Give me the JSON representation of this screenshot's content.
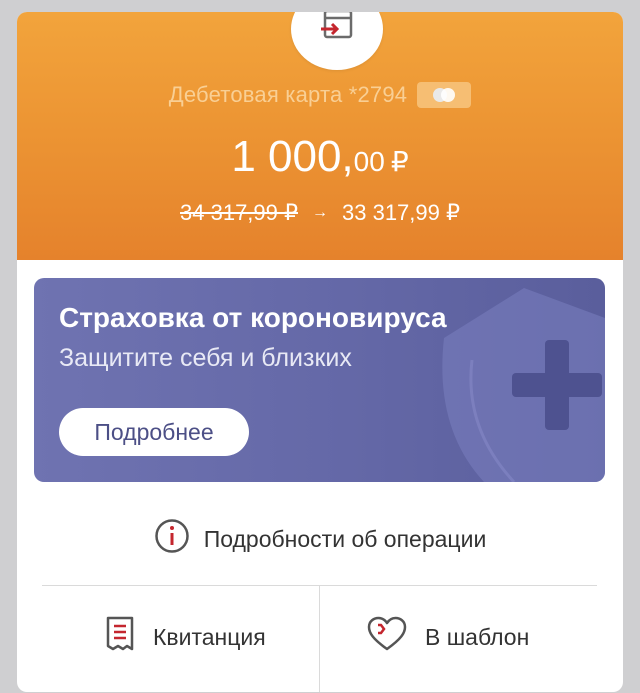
{
  "header": {
    "card_name": "Дебетовая карта *2794",
    "amount_int": "1 000,",
    "amount_frac": "00",
    "amount_currency": "₽",
    "balance_old": "34 317,99 ₽",
    "balance_arrow": "→",
    "balance_new": "33 317,99 ₽",
    "icon": "transfer-card-icon",
    "card_badge_icon": "payment-system-icon"
  },
  "banner": {
    "title": "Страховка от короновируса",
    "subtitle": "Защитите себя и близких",
    "button_label": "Подробнее",
    "icon": "shield-plus-icon"
  },
  "details": {
    "label": "Подробности об операции",
    "icon": "info-icon"
  },
  "actions": {
    "receipt_label": "Квитанция",
    "receipt_icon": "receipt-icon",
    "template_label": "В шаблон",
    "template_icon": "heart-icon"
  },
  "colors": {
    "header_orange": "#eb9232",
    "banner_purple": "#6468a7",
    "accent_red": "#c4262e"
  }
}
